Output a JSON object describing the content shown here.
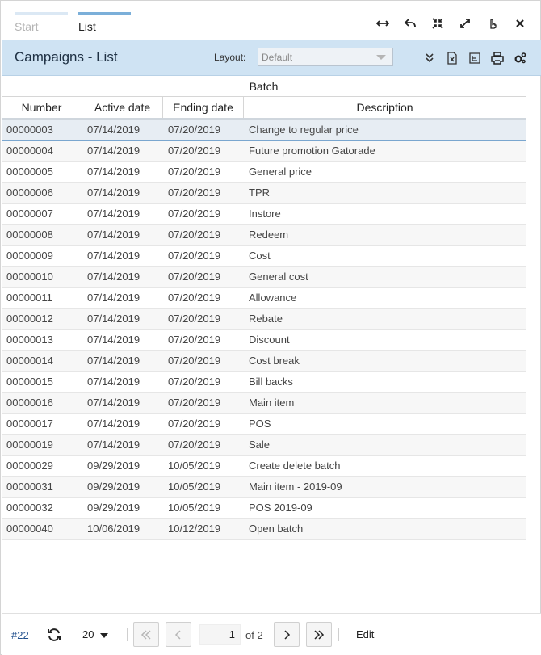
{
  "tabs": [
    {
      "label": "Start",
      "active": false
    },
    {
      "label": "List",
      "active": true
    }
  ],
  "window_icons": [
    "resize-horizontal-icon",
    "undo-icon",
    "collapse-icon",
    "expand-icon",
    "pointer-icon",
    "close-icon"
  ],
  "header": {
    "title": "Campaigns - List",
    "layout_label": "Layout:",
    "layout_value": "Default",
    "action_icons": [
      "double-chevron-down-icon",
      "excel-export-icon",
      "export-file-icon",
      "print-icon",
      "settings-gears-icon"
    ]
  },
  "grid": {
    "group_header": "Batch",
    "columns": [
      "Number",
      "Active date",
      "Ending date",
      "Description"
    ],
    "rows": [
      {
        "number": "00000003",
        "active": "07/14/2019",
        "ending": "07/20/2019",
        "description": "Change to regular price"
      },
      {
        "number": "00000004",
        "active": "07/14/2019",
        "ending": "07/20/2019",
        "description": "Future promotion Gatorade"
      },
      {
        "number": "00000005",
        "active": "07/14/2019",
        "ending": "07/20/2019",
        "description": "General price"
      },
      {
        "number": "00000006",
        "active": "07/14/2019",
        "ending": "07/20/2019",
        "description": "TPR"
      },
      {
        "number": "00000007",
        "active": "07/14/2019",
        "ending": "07/20/2019",
        "description": "Instore"
      },
      {
        "number": "00000008",
        "active": "07/14/2019",
        "ending": "07/20/2019",
        "description": "Redeem"
      },
      {
        "number": "00000009",
        "active": "07/14/2019",
        "ending": "07/20/2019",
        "description": "Cost"
      },
      {
        "number": "00000010",
        "active": "07/14/2019",
        "ending": "07/20/2019",
        "description": "General cost"
      },
      {
        "number": "00000011",
        "active": "07/14/2019",
        "ending": "07/20/2019",
        "description": "Allowance"
      },
      {
        "number": "00000012",
        "active": "07/14/2019",
        "ending": "07/20/2019",
        "description": "Rebate"
      },
      {
        "number": "00000013",
        "active": "07/14/2019",
        "ending": "07/20/2019",
        "description": "Discount"
      },
      {
        "number": "00000014",
        "active": "07/14/2019",
        "ending": "07/20/2019",
        "description": "Cost break"
      },
      {
        "number": "00000015",
        "active": "07/14/2019",
        "ending": "07/20/2019",
        "description": "Bill backs"
      },
      {
        "number": "00000016",
        "active": "07/14/2019",
        "ending": "07/20/2019",
        "description": "Main item"
      },
      {
        "number": "00000017",
        "active": "07/14/2019",
        "ending": "07/20/2019",
        "description": "POS"
      },
      {
        "number": "00000019",
        "active": "07/14/2019",
        "ending": "07/20/2019",
        "description": "Sale"
      },
      {
        "number": "00000029",
        "active": "09/29/2019",
        "ending": "10/05/2019",
        "description": "Create delete batch"
      },
      {
        "number": "00000031",
        "active": "09/29/2019",
        "ending": "10/05/2019",
        "description": "Main item - 2019-09"
      },
      {
        "number": "00000032",
        "active": "09/29/2019",
        "ending": "10/05/2019",
        "description": "POS 2019-09"
      },
      {
        "number": "00000040",
        "active": "10/06/2019",
        "ending": "10/12/2019",
        "description": "Open batch"
      }
    ]
  },
  "footer": {
    "record_link": "#22",
    "page_size": "20",
    "page_number": "1",
    "page_of": "of 2",
    "edit_label": "Edit"
  },
  "colors": {
    "title_bar": "#cfe3f3",
    "active_tab": "#7bafd9",
    "link": "#1f4e8c",
    "selected_row": "#e7edf3"
  }
}
